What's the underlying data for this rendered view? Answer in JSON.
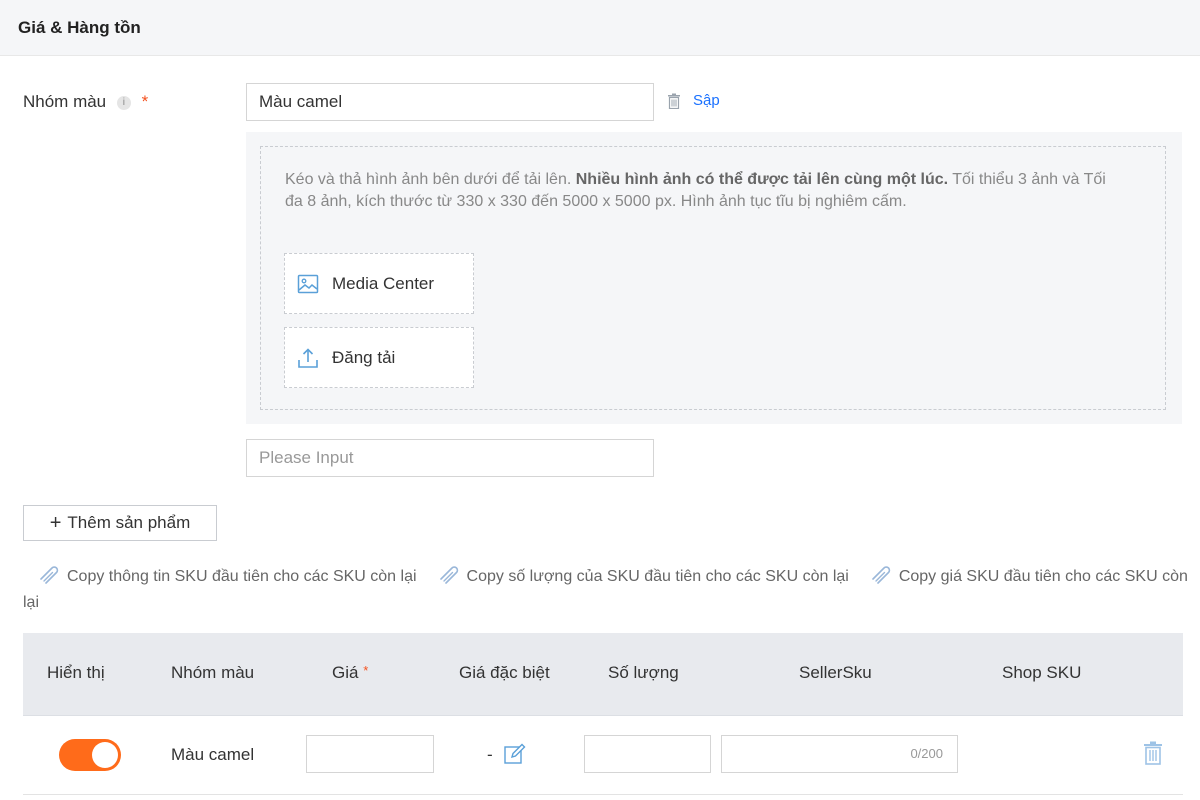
{
  "section": {
    "title": "Giá & Hàng tồn"
  },
  "color_group": {
    "label": "Nhóm màu",
    "info": "i",
    "required_mark": "*",
    "value": "Màu camel",
    "collapse_label": "Sập",
    "upload": {
      "hint_prefix": "Kéo và thả hình ảnh bên dưới để tải lên. ",
      "hint_bold": "Nhiều hình ảnh có thể được tải lên cùng một lúc.",
      "hint_suffix": " Tối thiểu 3 ảnh và Tối đa 8 ảnh, kích thước từ 330 x 330 đến 5000 x 5000 px. Hình ảnh tục tĩu bị nghiêm cấm.",
      "media_center_label": "Media Center",
      "upload_label": "Đăng tải"
    },
    "note_placeholder": "Please Input"
  },
  "add_product_label": "Thêm sản phẩm",
  "copy_links": [
    "Copy thông tin SKU đầu tiên cho các SKU còn lại",
    "Copy số lượng của SKU đầu tiên cho các SKU còn lại",
    "Copy giá SKU đầu tiên cho các SKU còn lại"
  ],
  "table": {
    "headers": {
      "visible": "Hiển thị",
      "color": "Nhóm màu",
      "price": "Giá",
      "price_required": "*",
      "special_price": "Giá đặc biệt",
      "quantity": "Số lượng",
      "seller_sku": "SellerSku",
      "shop_sku": "Shop SKU"
    },
    "rows": [
      {
        "visible": true,
        "color": "Màu camel",
        "price": "",
        "special_price": "-",
        "quantity": "",
        "seller_sku": "",
        "seller_sku_counter": "0/200",
        "shop_sku": ""
      }
    ]
  },
  "colors": {
    "accent": "#ff6b1a",
    "link": "#1a71ff",
    "icon_blue": "#5aa0d8",
    "required": "#f4511e"
  }
}
